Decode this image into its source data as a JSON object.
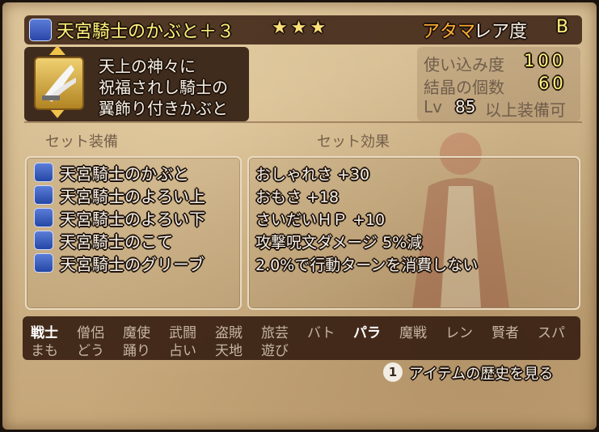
{
  "item": {
    "title": "天宮騎士のかぶと＋３",
    "stars": "★★★",
    "slot": "アタマ",
    "rarity_label": "レア度",
    "rarity_value": "B",
    "description": [
      "天上の神々に",
      "祝福されし騎士の",
      "翼飾り付きかぶと"
    ]
  },
  "stats": {
    "usage_label": "使い込み度",
    "usage_value": "100",
    "crystal_label": "結晶の個数",
    "crystal_value": "60",
    "lv_prefix": "Lv",
    "lv_value": "85",
    "lv_suffix": "以上装備可"
  },
  "set_section": {
    "equipment_title": "セット装備",
    "effects_title": "セット効果",
    "items": [
      "天宮騎士のかぶと",
      "天宮騎士のよろい上",
      "天宮騎士のよろい下",
      "天宮騎士のこて",
      "天宮騎士のグリーブ"
    ],
    "effects": [
      "おしゃれさ +30",
      "おもさ +18",
      "さいだいＨＰ +10",
      "攻撃呪文ダメージ 5%減",
      "2.0%で行動ターンを消費しない"
    ]
  },
  "jobs": {
    "row1": [
      "戦士",
      "僧侶",
      "魔使",
      "武闘",
      "盗賊",
      "旅芸",
      "バト",
      "パラ",
      "魔戦",
      "レン",
      "賢者",
      "スパ"
    ],
    "row2": [
      "まも",
      "どう",
      "踊り",
      "占い",
      "天地",
      "遊び"
    ]
  },
  "hint": {
    "button": "1",
    "text": "アイテムの歴史を見る"
  },
  "colors": {
    "title_yellow": "#fff27a",
    "slot_orange": "#ffae35",
    "panel_dark": "#3a2214",
    "parchment": "#cdb287"
  }
}
